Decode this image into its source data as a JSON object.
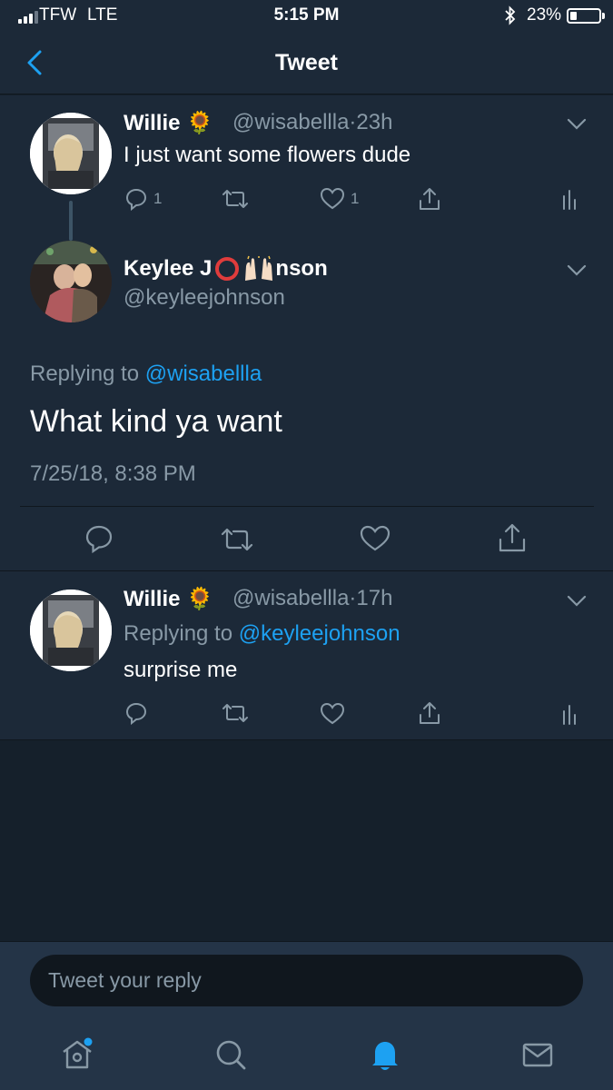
{
  "status_bar": {
    "carrier": "TFW",
    "network": "LTE",
    "time": "5:15 PM",
    "battery": "23%",
    "battery_level": 0.23
  },
  "header": {
    "title": "Tweet"
  },
  "tweet1": {
    "name": "Willie",
    "emoji": "🌻",
    "handle": "@wisabellla",
    "dot": "·",
    "time": "23h",
    "text": "I just want some flowers dude",
    "reply_count": "1",
    "like_count": "1"
  },
  "main_tweet": {
    "name_prefix": "Keylee J",
    "name_suffix": "nson",
    "handle": "@keyleejohnson",
    "replying_label": "Replying to",
    "replying_to": "@wisabellla",
    "text": "What kind ya want",
    "timestamp": "7/25/18, 8:38 PM"
  },
  "tweet3": {
    "name": "Willie",
    "emoji": "🌻",
    "handle": "@wisabellla",
    "dot": "·",
    "time": "17h",
    "replying_label": "Replying to",
    "replying_to": "@keyleejohnson",
    "text": "surprise me"
  },
  "composer": {
    "placeholder": "Tweet your reply"
  },
  "colors": {
    "accent": "#1da1f2",
    "background": "#15202b",
    "card": "#1c2938",
    "muted": "#8899a6"
  },
  "icons": [
    "back-chevron-icon",
    "reply-icon",
    "retweet-icon",
    "like-icon",
    "share-icon",
    "analytics-icon",
    "chevron-down-icon",
    "home-icon",
    "search-icon",
    "notifications-icon",
    "messages-icon"
  ]
}
